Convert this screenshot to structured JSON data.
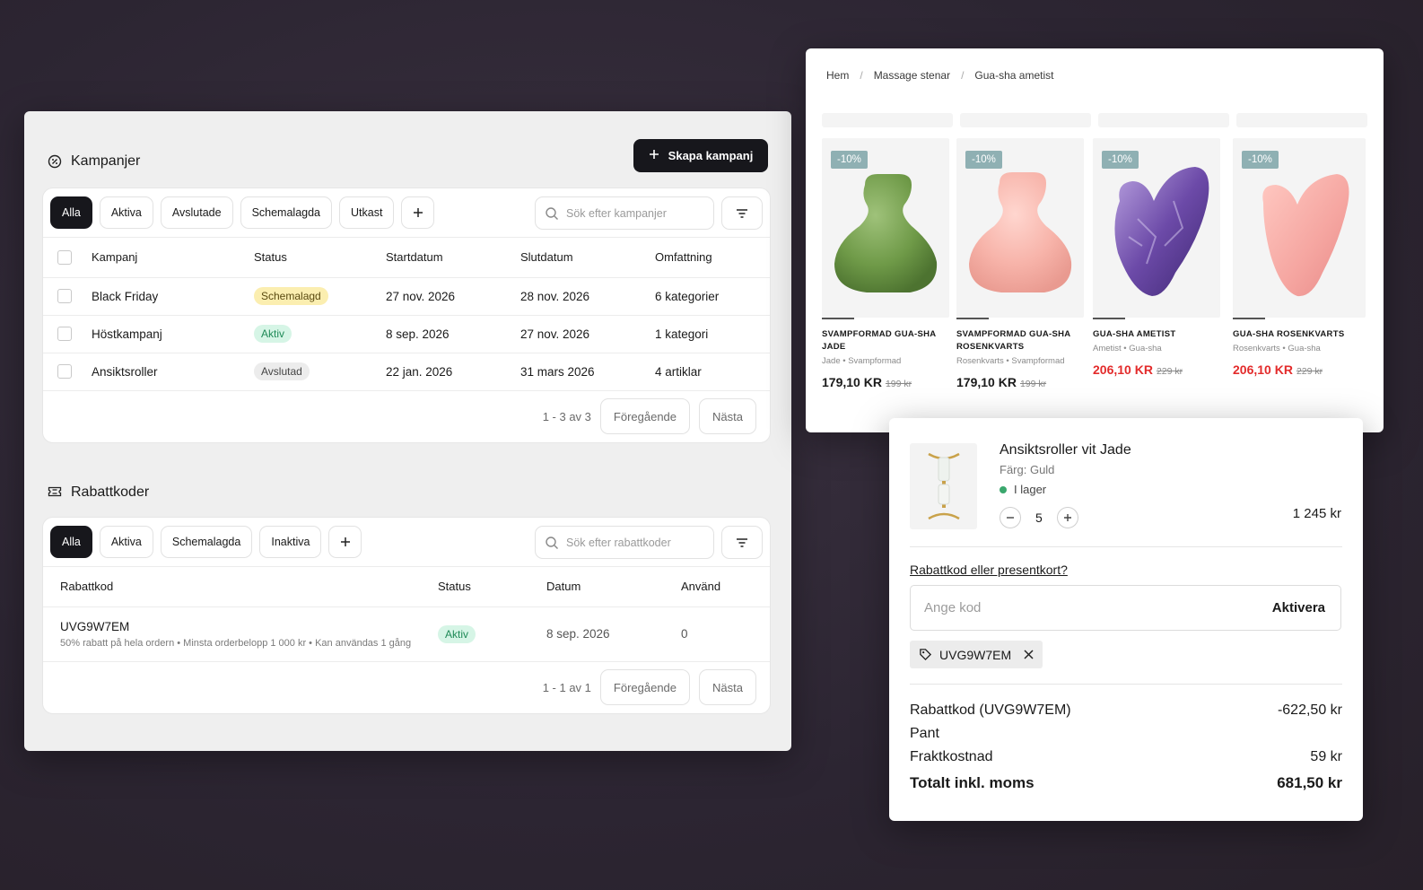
{
  "campaigns": {
    "title": "Kampanjer",
    "create_label": "Skapa kampanj",
    "tabs": [
      "Alla",
      "Aktiva",
      "Avslutade",
      "Schemalagda",
      "Utkast"
    ],
    "search_placeholder": "Sök efter kampanjer",
    "columns": [
      "Kampanj",
      "Status",
      "Startdatum",
      "Slutdatum",
      "Omfattning"
    ],
    "rows": [
      {
        "name": "Black Friday",
        "status": "Schemalagd",
        "start": "27 nov. 2026",
        "end": "28 nov. 2026",
        "scope": "6 kategorier"
      },
      {
        "name": "Höstkampanj",
        "status": "Aktiv",
        "start": "8 sep. 2026",
        "end": "27 nov. 2026",
        "scope": "1 kategori"
      },
      {
        "name": "Ansiktsroller",
        "status": "Avslutad",
        "start": "22 jan. 2026",
        "end": "31 mars 2026",
        "scope": "4 artiklar"
      }
    ],
    "pager_info": "1 - 3 av 3",
    "prev": "Föregående",
    "next": "Nästa"
  },
  "discounts": {
    "title": "Rabattkoder",
    "tabs": [
      "Alla",
      "Aktiva",
      "Schemalagda",
      "Inaktiva"
    ],
    "search_placeholder": "Sök efter rabattkoder",
    "columns": [
      "Rabattkod",
      "Status",
      "Datum",
      "Använd"
    ],
    "rows": [
      {
        "code": "UVG9W7EM",
        "desc": "50% rabatt på hela ordern • Minsta orderbelopp 1 000 kr • Kan användas 1 gång",
        "status": "Aktiv",
        "date": "8 sep. 2026",
        "used": "0"
      }
    ],
    "pager_info": "1 - 1 av 1",
    "prev": "Föregående",
    "next": "Nästa"
  },
  "shop": {
    "breadcrumb": [
      "Hem",
      "Massage stenar",
      "Gua-sha ametist"
    ],
    "products": [
      {
        "discount": "-10%",
        "name": "SVAMPFORMAD GUA-SHA JADE",
        "meta": "Jade • Svampformad",
        "price": "179,10 KR",
        "old": "199 kr",
        "sale": false
      },
      {
        "discount": "-10%",
        "name": "SVAMPFORMAD GUA-SHA ROSENKVARTS",
        "meta": "Rosenkvarts • Svampformad",
        "price": "179,10 KR",
        "old": "199 kr",
        "sale": false
      },
      {
        "discount": "-10%",
        "name": "GUA-SHA AMETIST",
        "meta": "Ametist • Gua-sha",
        "price": "206,10 KR",
        "old": "229 kr",
        "sale": true
      },
      {
        "discount": "-10%",
        "name": "GUA-SHA ROSENKVARTS",
        "meta": "Rosenkvarts • Gua-sha",
        "price": "206,10 KR",
        "old": "229 kr",
        "sale": true
      }
    ]
  },
  "cart": {
    "item_name": "Ansiktsroller vit Jade",
    "color": "Färg: Guld",
    "stock": "I lager",
    "qty": "5",
    "price": "1 245 kr",
    "promo_link": "Rabattkod eller presentkort?",
    "code_placeholder": "Ange kod",
    "activate": "Aktivera",
    "applied_code": "UVG9W7EM",
    "summary": [
      {
        "label": "Rabattkod (UVG9W7EM)",
        "value": "-622,50 kr"
      },
      {
        "label": "Pant",
        "value": ""
      },
      {
        "label": "Fraktkostnad",
        "value": "59 kr"
      }
    ],
    "total_label": "Totalt inkl. moms",
    "total_value": "681,50 kr"
  },
  "colors": {
    "dark": "#17171c",
    "scheduled_bg": "#fbeeb0",
    "active_bg": "#d6f5e6",
    "active_text": "#1f8a57",
    "ended_bg": "#ececec",
    "sale_red": "#e32b2b",
    "discount_badge": "#8fb0b3",
    "stock_dot": "#3aa76d"
  },
  "icons": [
    "campaign-icon",
    "ticket-icon",
    "plus-icon",
    "search-icon",
    "filter-icon",
    "tag-icon",
    "close-icon",
    "minus-icon"
  ]
}
